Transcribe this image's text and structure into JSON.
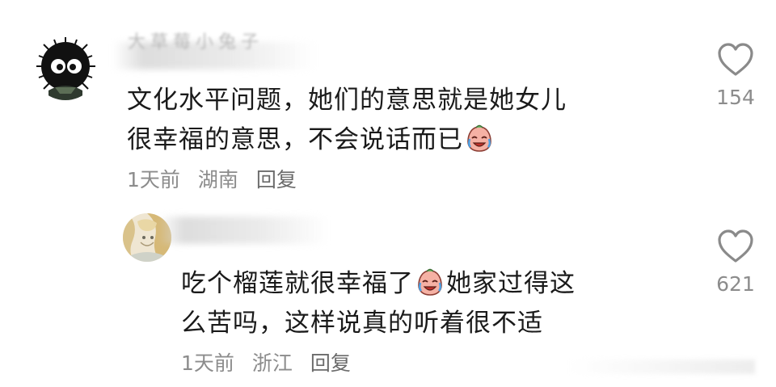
{
  "comments": [
    {
      "username_fragment": "大草莓小兔子",
      "text_line1": "文化水平问题，她们的意思就是她女儿",
      "text_line2": "很幸福的意思，不会说话而已",
      "emoji": "crying-face-emoji",
      "time": "1天前",
      "location": "湖南",
      "reply_label": "回复",
      "like_count": "154"
    },
    {
      "text_line1_a": "吃个榴莲就很幸福了",
      "text_line1_b": "她家过得这",
      "text_line2": "么苦吗，这样说真的听着很不适",
      "emoji": "crying-face-emoji",
      "time": "1天前",
      "location": "浙江",
      "reply_label": "回复",
      "like_count": "621"
    }
  ],
  "icons": {
    "like": "heart-outline-icon"
  },
  "colors": {
    "text": "#1a1a1a",
    "meta": "#8c8c8c",
    "background": "#ffffff"
  }
}
